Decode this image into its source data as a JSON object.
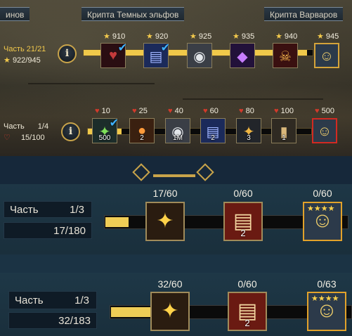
{
  "tabs": {
    "left_partial": "инов",
    "dark_elves": "Крипта Темных эльфов",
    "barbarians": "Крипта Варваров"
  },
  "row1": {
    "part_label": "Часть 21/21",
    "progress_text": "922/945",
    "progress_fraction": 0.976,
    "items": [
      {
        "req": "910",
        "icon": "heart-demon-icon",
        "checked": true
      },
      {
        "req": "920",
        "icon": "spellbook-icon",
        "checked": true
      },
      {
        "req": "925",
        "icon": "silver-coin-icon",
        "checked": false
      },
      {
        "req": "935",
        "icon": "purple-crystal-icon",
        "checked": false
      },
      {
        "req": "940",
        "icon": "red-demon-skull-icon",
        "checked": false
      },
      {
        "req": "945",
        "icon": "champion-portrait-icon",
        "checked": false
      }
    ]
  },
  "row2": {
    "part_label": "Часть",
    "part_num": "1/4",
    "progress_text": "15/100",
    "progress_fraction": 0.15,
    "items": [
      {
        "req": "10",
        "icon": "green-shard-icon",
        "badge": "500",
        "checked": true
      },
      {
        "req": "25",
        "icon": "orange-potion-icon",
        "badge": "2",
        "checked": false
      },
      {
        "req": "40",
        "icon": "silver-coin-icon",
        "badge": "1M",
        "checked": false
      },
      {
        "req": "60",
        "icon": "spellbook-icon",
        "badge": "2",
        "checked": false
      },
      {
        "req": "80",
        "icon": "spiked-helmet-icon",
        "badge": "3",
        "checked": false
      },
      {
        "req": "100",
        "icon": "brass-bracer-icon",
        "badge": "1",
        "checked": false
      },
      {
        "req": "500",
        "icon": "champion-portrait-icon",
        "badge": "",
        "checked": false
      }
    ]
  },
  "row3": {
    "part_label": "Часть",
    "part_num": "1/3",
    "progress_text": "17/180",
    "progress_fraction": 0.094,
    "items": [
      {
        "count": "17/60",
        "icon": "gold-helmet-shard-icon",
        "badge": ""
      },
      {
        "count": "0/60",
        "icon": "red-tome-icon",
        "badge": "2"
      },
      {
        "count": "0/60",
        "icon": "champion-portrait-icon",
        "badge": ""
      }
    ]
  },
  "row4": {
    "part_label": "Часть",
    "part_num": "1/3",
    "progress_text": "32/183",
    "progress_fraction": 0.175,
    "items": [
      {
        "count": "32/60",
        "icon": "gold-helmet-shard-icon",
        "badge": ""
      },
      {
        "count": "0/60",
        "icon": "red-tome-icon",
        "badge": "2"
      },
      {
        "count": "0/63",
        "icon": "champion-portrait-icon",
        "badge": ""
      }
    ]
  },
  "colors": {
    "accent_gold": "#f0c94a",
    "check_blue": "#3fb2ff",
    "drop_red": "#d33a2b"
  }
}
